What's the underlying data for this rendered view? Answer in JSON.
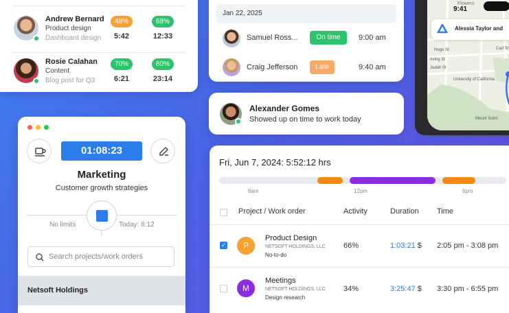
{
  "team": [
    {
      "name": "Andrew Bernard",
      "role": "Product design",
      "task": "Dashboard design",
      "pct1": "48%",
      "pct2": "68%",
      "t1": "5:42",
      "t2": "12:33",
      "color1": "#f7a133",
      "color2": "#2cc36b"
    },
    {
      "name": "Rosie Calahan",
      "role": "Content",
      "task": "Blog post for Q3",
      "pct1": "70%",
      "pct2": "80%",
      "t1": "6:21",
      "t2": "23:14",
      "color1": "#2cc36b",
      "color2": "#2cc36b"
    }
  ],
  "attendance": {
    "date": "Jan 22, 2025",
    "rows": [
      {
        "name": "Samuel Ross...",
        "status": "On time",
        "time": "9:00 am"
      },
      {
        "name": "Craig Jefferson",
        "status": "Late",
        "time": "9:40 am"
      }
    ]
  },
  "notification": {
    "name": "Alexander Gomes",
    "message": "Showed up on time to work today"
  },
  "phone": {
    "time": "9:41",
    "contact": "Alessia Taylor and",
    "map_labels": [
      "Hugo St",
      "Carl St",
      "Irving St",
      "Judah St",
      "University of California",
      "Mount Sutro",
      "Flowers"
    ]
  },
  "timer": {
    "elapsed": "01:08:23",
    "project": "Marketing",
    "task": "Customer growth strategies",
    "limit": "No limits",
    "today": "Today: 8:12",
    "search_placeholder": "Search projects/work orders",
    "organization": "Netsoft Holdings"
  },
  "timesheet": {
    "title": "Fri, Jun 7, 2024: 5:52:12 hrs",
    "ticks": [
      "6am",
      "12pm",
      "6pm"
    ],
    "columns": [
      "Project / Work order",
      "Activity",
      "Duration",
      "Time"
    ],
    "rows": [
      {
        "initial": "P",
        "color": "#f7a133",
        "project": "Product Design",
        "org": "NETSOFT HOLDINGS, LLC",
        "task": "No-to-do",
        "activity": "66%",
        "duration": "1:03:21",
        "currency": "$",
        "time": "2:05 pm - 3:08 pm",
        "checked": true
      },
      {
        "initial": "M",
        "color": "#8b2be2",
        "project": "Meetings",
        "org": "NETSOFT HOLDINGS, LLC",
        "task": "Design research",
        "activity": "34%",
        "duration": "3:25:47",
        "currency": "$",
        "time": "3:30 pm - 6:55 pm",
        "checked": false
      }
    ]
  },
  "colors": {
    "accent": "#2b7de9",
    "green": "#2cc36b",
    "orange": "#f7a133",
    "purple": "#8b2be2"
  }
}
